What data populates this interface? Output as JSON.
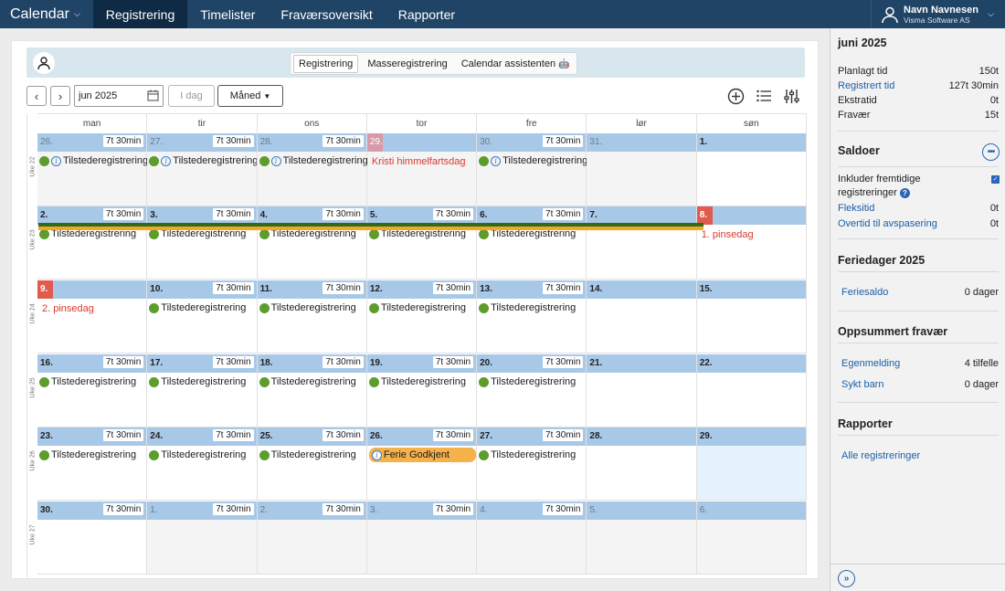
{
  "nav": {
    "brand": "Calendar",
    "items": [
      "Registrering",
      "Timelister",
      "Fraværsoversikt",
      "Rapporter"
    ],
    "active": 0
  },
  "user": {
    "name": "Navn Navnesen",
    "company": "Visma Software AS"
  },
  "subtabs": [
    "Registrering",
    "Masseregistrering",
    "Calendar assistenten"
  ],
  "toolbar": {
    "prev": "‹",
    "next": "›",
    "month": "jun 2025",
    "today": "I dag",
    "view": "Måned"
  },
  "dayheaders": [
    "man",
    "tir",
    "ons",
    "tor",
    "fre",
    "lør",
    "søn"
  ],
  "weeks": [
    {
      "label": "Uke 22",
      "days": [
        {
          "num": "26.",
          "hrs": "7t 30min",
          "out": true,
          "ev": "Tilstederegistrering",
          "info": true
        },
        {
          "num": "27.",
          "hrs": "7t 30min",
          "out": true,
          "ev": "Tilstederegistrering",
          "info": true
        },
        {
          "num": "28.",
          "hrs": "7t 30min",
          "out": true,
          "ev": "Tilstederegistrering",
          "info": true
        },
        {
          "num": "29.",
          "out": true,
          "holiday": "Kristi himmelfartsdag",
          "redlite": true
        },
        {
          "num": "30.",
          "hrs": "7t 30min",
          "out": true,
          "ev": "Tilstederegistrering",
          "info": true
        },
        {
          "num": "31.",
          "out": true
        },
        {
          "num": "1."
        }
      ]
    },
    {
      "label": "Uke 23",
      "days": [
        {
          "num": "2.",
          "hrs": "7t 30min",
          "ev": "Tilstederegistrering"
        },
        {
          "num": "3.",
          "hrs": "7t 30min",
          "ev": "Tilstederegistrering"
        },
        {
          "num": "4.",
          "hrs": "7t 30min",
          "ev": "Tilstederegistrering"
        },
        {
          "num": "5.",
          "hrs": "7t 30min",
          "ev": "Tilstederegistrering"
        },
        {
          "num": "6.",
          "hrs": "7t 30min",
          "ev": "Tilstederegistrering"
        },
        {
          "num": "7."
        },
        {
          "num": "8.",
          "red": true,
          "holiday": "1. pinsedag"
        }
      ]
    },
    {
      "label": "Uke 24",
      "days": [
        {
          "num": "9.",
          "red": true,
          "holiday": "2. pinsedag"
        },
        {
          "num": "10.",
          "hrs": "7t 30min",
          "ev": "Tilstederegistrering"
        },
        {
          "num": "11.",
          "hrs": "7t 30min",
          "ev": "Tilstederegistrering"
        },
        {
          "num": "12.",
          "hrs": "7t 30min",
          "ev": "Tilstederegistrering"
        },
        {
          "num": "13.",
          "hrs": "7t 30min",
          "ev": "Tilstederegistrering"
        },
        {
          "num": "14."
        },
        {
          "num": "15."
        }
      ]
    },
    {
      "label": "Uke 25",
      "days": [
        {
          "num": "16.",
          "hrs": "7t 30min",
          "ev": "Tilstederegistrering"
        },
        {
          "num": "17.",
          "hrs": "7t 30min",
          "ev": "Tilstederegistrering"
        },
        {
          "num": "18.",
          "hrs": "7t 30min",
          "ev": "Tilstederegistrering"
        },
        {
          "num": "19.",
          "hrs": "7t 30min",
          "ev": "Tilstederegistrering"
        },
        {
          "num": "20.",
          "hrs": "7t 30min",
          "ev": "Tilstederegistrering"
        },
        {
          "num": "21."
        },
        {
          "num": "22."
        }
      ]
    },
    {
      "label": "Uke 26",
      "days": [
        {
          "num": "23.",
          "hrs": "7t 30min",
          "ev": "Tilstederegistrering"
        },
        {
          "num": "24.",
          "hrs": "7t 30min",
          "ev": "Tilstederegistrering"
        },
        {
          "num": "25.",
          "hrs": "7t 30min",
          "ev": "Tilstederegistrering"
        },
        {
          "num": "26.",
          "hrs": "7t 30min",
          "vacation": "Ferie Godkjent"
        },
        {
          "num": "27.",
          "hrs": "7t 30min",
          "ev": "Tilstederegistrering"
        },
        {
          "num": "28."
        },
        {
          "num": "29.",
          "selected": true
        }
      ]
    },
    {
      "label": "Uke 27",
      "days": [
        {
          "num": "30.",
          "hrs": "7t 30min"
        },
        {
          "num": "1.",
          "hrs": "7t 30min",
          "out": true
        },
        {
          "num": "2.",
          "hrs": "7t 30min",
          "out": true
        },
        {
          "num": "3.",
          "hrs": "7t 30min",
          "out": true
        },
        {
          "num": "4.",
          "hrs": "7t 30min",
          "out": true
        },
        {
          "num": "5.",
          "out": true
        },
        {
          "num": "6.",
          "out": true
        }
      ]
    }
  ],
  "side": {
    "month": "juni 2025",
    "summary": [
      {
        "label": "Planlagt tid",
        "value": "150t"
      },
      {
        "label": "Registrert tid",
        "value": "127t 30min",
        "link": true
      },
      {
        "label": "Ekstratid",
        "value": "0t"
      },
      {
        "label": "Fravær",
        "value": "15t"
      }
    ],
    "saldoer": "Saldoer",
    "include_future_1": "Inkluder fremtidige",
    "include_future_2": "registreringer",
    "balances": [
      {
        "label": "Fleksitid",
        "value": "0t"
      },
      {
        "label": "Overtid til avspasering",
        "value": "0t"
      }
    ],
    "vacation_title": "Feriedager 2025",
    "vacation": {
      "label": "Feriesaldo",
      "value": "0 dager"
    },
    "absence_title": "Oppsummert fravær",
    "absence": [
      {
        "label": "Egenmelding",
        "value": "4 tilfelle"
      },
      {
        "label": "Sykt barn",
        "value": "0 dager"
      }
    ],
    "reports_title": "Rapporter",
    "reports_link": "Alle registreringer"
  }
}
